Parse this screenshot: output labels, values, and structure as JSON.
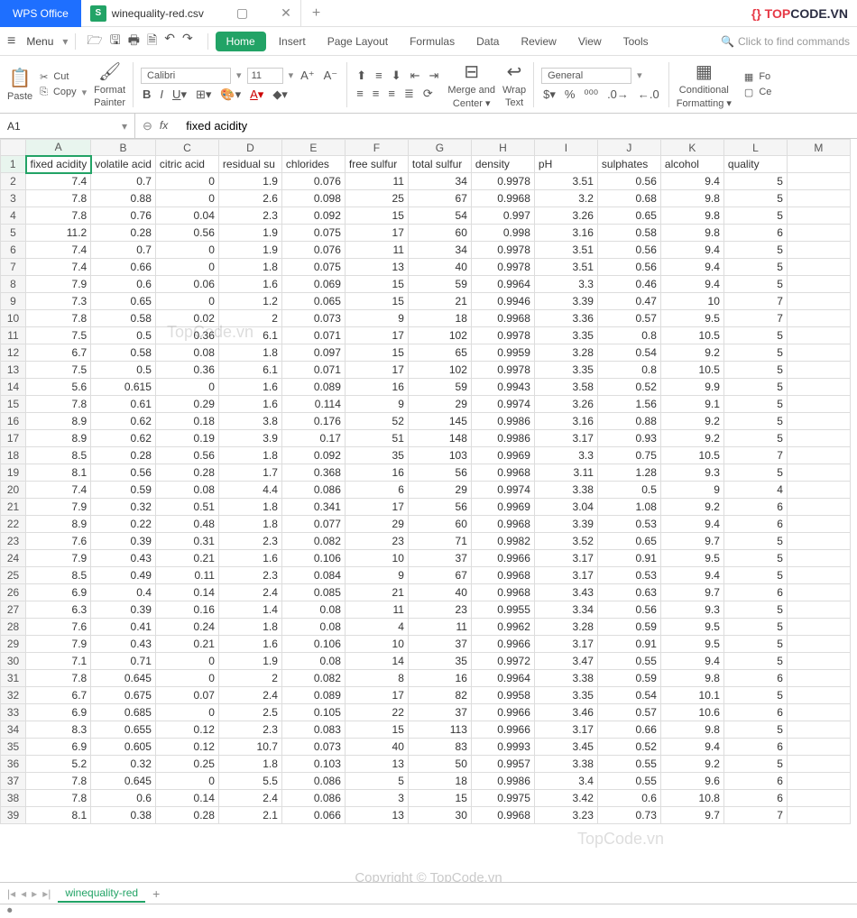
{
  "app": {
    "name": "WPS Office"
  },
  "file_tab": {
    "icon": "S",
    "name": "winequality-red.csv"
  },
  "logo": {
    "prefix": "TOP",
    "suffix": "CODE.VN"
  },
  "menubar": {
    "menu": "Menu",
    "tabs": {
      "home": "Home",
      "insert": "Insert",
      "page_layout": "Page Layout",
      "formulas": "Formulas",
      "data": "Data",
      "review": "Review",
      "view": "View",
      "tools": "Tools"
    },
    "search": "Click to find commands"
  },
  "ribbon": {
    "paste": "Paste",
    "cut": "Cut",
    "copy": "Copy",
    "format_painter1": "Format",
    "format_painter2": "Painter",
    "font": "Calibri",
    "size": "11",
    "merge1": "Merge and",
    "merge2": "Center",
    "wrap1": "Wrap",
    "wrap2": "Text",
    "number_format": "General",
    "cond_fmt1": "Conditional",
    "cond_fmt2": "Formatting",
    "fo": "Fo",
    "ce": "Ce"
  },
  "namebox": "A1",
  "formula": "fixed acidity",
  "columns": [
    "A",
    "B",
    "C",
    "D",
    "E",
    "F",
    "G",
    "H",
    "I",
    "J",
    "K",
    "L",
    "M"
  ],
  "headers": [
    "fixed acidity",
    "volatile acid",
    "citric acid",
    "residual su",
    "chlorides",
    "free sulfur",
    "total sulfur",
    "density",
    "pH",
    "sulphates",
    "alcohol",
    "quality",
    ""
  ],
  "rows": [
    [
      "7.4",
      "0.7",
      "0",
      "1.9",
      "0.076",
      "11",
      "34",
      "0.9978",
      "3.51",
      "0.56",
      "9.4",
      "5",
      ""
    ],
    [
      "7.8",
      "0.88",
      "0",
      "2.6",
      "0.098",
      "25",
      "67",
      "0.9968",
      "3.2",
      "0.68",
      "9.8",
      "5",
      ""
    ],
    [
      "7.8",
      "0.76",
      "0.04",
      "2.3",
      "0.092",
      "15",
      "54",
      "0.997",
      "3.26",
      "0.65",
      "9.8",
      "5",
      ""
    ],
    [
      "11.2",
      "0.28",
      "0.56",
      "1.9",
      "0.075",
      "17",
      "60",
      "0.998",
      "3.16",
      "0.58",
      "9.8",
      "6",
      ""
    ],
    [
      "7.4",
      "0.7",
      "0",
      "1.9",
      "0.076",
      "11",
      "34",
      "0.9978",
      "3.51",
      "0.56",
      "9.4",
      "5",
      ""
    ],
    [
      "7.4",
      "0.66",
      "0",
      "1.8",
      "0.075",
      "13",
      "40",
      "0.9978",
      "3.51",
      "0.56",
      "9.4",
      "5",
      ""
    ],
    [
      "7.9",
      "0.6",
      "0.06",
      "1.6",
      "0.069",
      "15",
      "59",
      "0.9964",
      "3.3",
      "0.46",
      "9.4",
      "5",
      ""
    ],
    [
      "7.3",
      "0.65",
      "0",
      "1.2",
      "0.065",
      "15",
      "21",
      "0.9946",
      "3.39",
      "0.47",
      "10",
      "7",
      ""
    ],
    [
      "7.8",
      "0.58",
      "0.02",
      "2",
      "0.073",
      "9",
      "18",
      "0.9968",
      "3.36",
      "0.57",
      "9.5",
      "7",
      ""
    ],
    [
      "7.5",
      "0.5",
      "0.36",
      "6.1",
      "0.071",
      "17",
      "102",
      "0.9978",
      "3.35",
      "0.8",
      "10.5",
      "5",
      ""
    ],
    [
      "6.7",
      "0.58",
      "0.08",
      "1.8",
      "0.097",
      "15",
      "65",
      "0.9959",
      "3.28",
      "0.54",
      "9.2",
      "5",
      ""
    ],
    [
      "7.5",
      "0.5",
      "0.36",
      "6.1",
      "0.071",
      "17",
      "102",
      "0.9978",
      "3.35",
      "0.8",
      "10.5",
      "5",
      ""
    ],
    [
      "5.6",
      "0.615",
      "0",
      "1.6",
      "0.089",
      "16",
      "59",
      "0.9943",
      "3.58",
      "0.52",
      "9.9",
      "5",
      ""
    ],
    [
      "7.8",
      "0.61",
      "0.29",
      "1.6",
      "0.114",
      "9",
      "29",
      "0.9974",
      "3.26",
      "1.56",
      "9.1",
      "5",
      ""
    ],
    [
      "8.9",
      "0.62",
      "0.18",
      "3.8",
      "0.176",
      "52",
      "145",
      "0.9986",
      "3.16",
      "0.88",
      "9.2",
      "5",
      ""
    ],
    [
      "8.9",
      "0.62",
      "0.19",
      "3.9",
      "0.17",
      "51",
      "148",
      "0.9986",
      "3.17",
      "0.93",
      "9.2",
      "5",
      ""
    ],
    [
      "8.5",
      "0.28",
      "0.56",
      "1.8",
      "0.092",
      "35",
      "103",
      "0.9969",
      "3.3",
      "0.75",
      "10.5",
      "7",
      ""
    ],
    [
      "8.1",
      "0.56",
      "0.28",
      "1.7",
      "0.368",
      "16",
      "56",
      "0.9968",
      "3.11",
      "1.28",
      "9.3",
      "5",
      ""
    ],
    [
      "7.4",
      "0.59",
      "0.08",
      "4.4",
      "0.086",
      "6",
      "29",
      "0.9974",
      "3.38",
      "0.5",
      "9",
      "4",
      ""
    ],
    [
      "7.9",
      "0.32",
      "0.51",
      "1.8",
      "0.341",
      "17",
      "56",
      "0.9969",
      "3.04",
      "1.08",
      "9.2",
      "6",
      ""
    ],
    [
      "8.9",
      "0.22",
      "0.48",
      "1.8",
      "0.077",
      "29",
      "60",
      "0.9968",
      "3.39",
      "0.53",
      "9.4",
      "6",
      ""
    ],
    [
      "7.6",
      "0.39",
      "0.31",
      "2.3",
      "0.082",
      "23",
      "71",
      "0.9982",
      "3.52",
      "0.65",
      "9.7",
      "5",
      ""
    ],
    [
      "7.9",
      "0.43",
      "0.21",
      "1.6",
      "0.106",
      "10",
      "37",
      "0.9966",
      "3.17",
      "0.91",
      "9.5",
      "5",
      ""
    ],
    [
      "8.5",
      "0.49",
      "0.11",
      "2.3",
      "0.084",
      "9",
      "67",
      "0.9968",
      "3.17",
      "0.53",
      "9.4",
      "5",
      ""
    ],
    [
      "6.9",
      "0.4",
      "0.14",
      "2.4",
      "0.085",
      "21",
      "40",
      "0.9968",
      "3.43",
      "0.63",
      "9.7",
      "6",
      ""
    ],
    [
      "6.3",
      "0.39",
      "0.16",
      "1.4",
      "0.08",
      "11",
      "23",
      "0.9955",
      "3.34",
      "0.56",
      "9.3",
      "5",
      ""
    ],
    [
      "7.6",
      "0.41",
      "0.24",
      "1.8",
      "0.08",
      "4",
      "11",
      "0.9962",
      "3.28",
      "0.59",
      "9.5",
      "5",
      ""
    ],
    [
      "7.9",
      "0.43",
      "0.21",
      "1.6",
      "0.106",
      "10",
      "37",
      "0.9966",
      "3.17",
      "0.91",
      "9.5",
      "5",
      ""
    ],
    [
      "7.1",
      "0.71",
      "0",
      "1.9",
      "0.08",
      "14",
      "35",
      "0.9972",
      "3.47",
      "0.55",
      "9.4",
      "5",
      ""
    ],
    [
      "7.8",
      "0.645",
      "0",
      "2",
      "0.082",
      "8",
      "16",
      "0.9964",
      "3.38",
      "0.59",
      "9.8",
      "6",
      ""
    ],
    [
      "6.7",
      "0.675",
      "0.07",
      "2.4",
      "0.089",
      "17",
      "82",
      "0.9958",
      "3.35",
      "0.54",
      "10.1",
      "5",
      ""
    ],
    [
      "6.9",
      "0.685",
      "0",
      "2.5",
      "0.105",
      "22",
      "37",
      "0.9966",
      "3.46",
      "0.57",
      "10.6",
      "6",
      ""
    ],
    [
      "8.3",
      "0.655",
      "0.12",
      "2.3",
      "0.083",
      "15",
      "113",
      "0.9966",
      "3.17",
      "0.66",
      "9.8",
      "5",
      ""
    ],
    [
      "6.9",
      "0.605",
      "0.12",
      "10.7",
      "0.073",
      "40",
      "83",
      "0.9993",
      "3.45",
      "0.52",
      "9.4",
      "6",
      ""
    ],
    [
      "5.2",
      "0.32",
      "0.25",
      "1.8",
      "0.103",
      "13",
      "50",
      "0.9957",
      "3.38",
      "0.55",
      "9.2",
      "5",
      ""
    ],
    [
      "7.8",
      "0.645",
      "0",
      "5.5",
      "0.086",
      "5",
      "18",
      "0.9986",
      "3.4",
      "0.55",
      "9.6",
      "6",
      ""
    ],
    [
      "7.8",
      "0.6",
      "0.14",
      "2.4",
      "0.086",
      "3",
      "15",
      "0.9975",
      "3.42",
      "0.6",
      "10.8",
      "6",
      ""
    ],
    [
      "8.1",
      "0.38",
      "0.28",
      "2.1",
      "0.066",
      "13",
      "30",
      "0.9968",
      "3.23",
      "0.73",
      "9.7",
      "7",
      ""
    ]
  ],
  "sheet_tab": "winequality-red",
  "watermark": "TopCode.vn",
  "copyright": "Copyright © TopCode.vn"
}
